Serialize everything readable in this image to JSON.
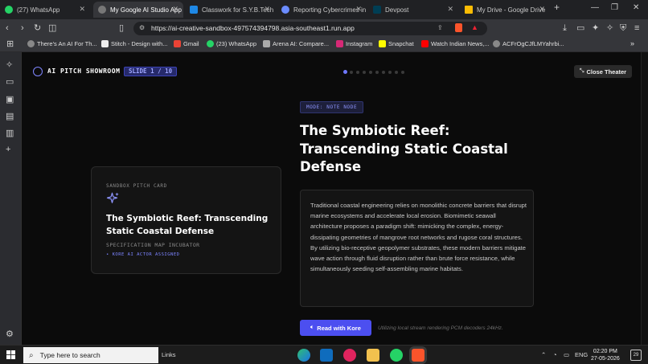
{
  "browser": {
    "tabs": [
      {
        "label": "(27) WhatsApp",
        "active": false,
        "icon": "whatsapp-icon"
      },
      {
        "label": "My Google AI Studio App",
        "active": true,
        "icon": "globe-icon"
      },
      {
        "label": "Classwork for S.Y.B.Tech (E",
        "active": false,
        "icon": "classroom-icon"
      },
      {
        "label": "Reporting Cybercrimes in I",
        "active": false,
        "icon": "gemini-icon"
      },
      {
        "label": "Devpost",
        "active": false,
        "icon": "devpost-icon"
      },
      {
        "label": "My Drive - Google Drive",
        "active": false,
        "icon": "drive-icon"
      }
    ],
    "new_tab": "+",
    "url": "https://ai-creative-sandbox-497574394798.asia-southeast1.run.app",
    "bookmarks": [
      "There's An AI For Th...",
      "Stitch - Design with...",
      "Gmail",
      "(23) WhatsApp",
      "Arena AI: Compare...",
      "Instagram",
      "Snapchat",
      "Watch Indian News,...",
      "ACFrOgCJfLMYahrbi..."
    ],
    "bookmarks_more": "»"
  },
  "app": {
    "title": "AI PITCH SHOWROOM",
    "slide_counter": "SLIDE 1 / 10",
    "dots_total": 10,
    "dots_active": 1,
    "close_label": "Close Theater",
    "card": {
      "kicker": "SANDBOX PITCH CARD",
      "title": "The Symbiotic Reef: Transcending Static Coastal Defense",
      "spec": "SPECIFICATION MAP INCUBATOR",
      "actor": "• KORE AI ACTOR ASSIGNED"
    },
    "mode_badge": "MODE: NOTE NODE",
    "main_title": "The Symbiotic Reef: Transcending Static Coastal Defense",
    "body": "Traditional coastal engineering relies on monolithic concrete barriers that disrupt marine ecosystems and accelerate local erosion. Biomimetic seawall architecture proposes a paradigm shift: mimicking the complex, energy-dissipating geometries of mangrove root networks and rugose coral structures. By utilizing bio-receptive geopolymer substrates, these modern barriers mitigate wave action through fluid disruption rather than brute force resistance, while simultaneously seeding self-assembling marine habitats.",
    "read_button": "Read with Kore",
    "stream_note": "Utilizing local stream rendering PCM decoders 24kHz.",
    "accent": "#4c4ff0"
  },
  "taskbar": {
    "search_placeholder": "Type here to search",
    "links": "Links",
    "lang": "ENG",
    "time": "02:20 PM",
    "date": "27-05-2026",
    "notifications": "29"
  }
}
